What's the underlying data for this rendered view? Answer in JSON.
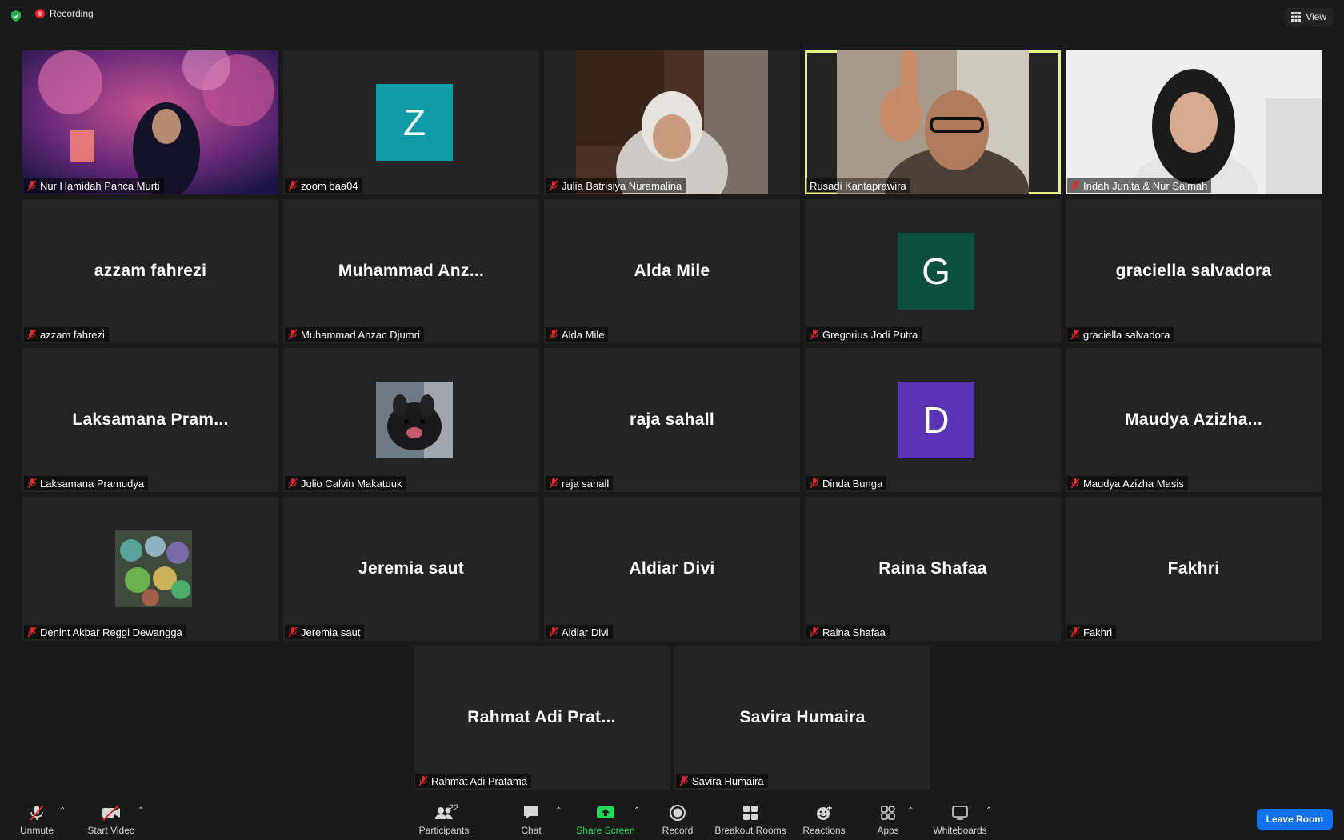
{
  "topbar": {
    "recording_label": "Recording",
    "view_label": "View"
  },
  "participants": [
    {
      "label": "Nur Hamidah Panca Murti"
    },
    {
      "label": "zoom baa04",
      "avatar_letter": "Z",
      "avatar_color": "#0e9aa7"
    },
    {
      "label": "Julia Batrisiya Nuramalina"
    },
    {
      "label": "Rusadi Kantaprawira"
    },
    {
      "label": "Indah Junita & Nur Salmah"
    },
    {
      "label": "azzam fahrezi",
      "display": "azzam fahrezi"
    },
    {
      "label": "Muhammad Anzac Djumri",
      "display": "Muhammad  Anz..."
    },
    {
      "label": "Alda Mile",
      "display": "Alda Mile"
    },
    {
      "label": "Gregorius Jodi Putra",
      "avatar_letter": "G",
      "avatar_color": "#0b4f3f"
    },
    {
      "label": "graciella salvadora",
      "display": "graciella salvadora"
    },
    {
      "label": "Laksamana Pramudya",
      "display": "Laksamana  Pram..."
    },
    {
      "label": "Julio Calvin Makatuuk"
    },
    {
      "label": "raja sahall",
      "display": "raja sahall"
    },
    {
      "label": "Dinda Bunga",
      "avatar_letter": "D",
      "avatar_color": "#5b33b5"
    },
    {
      "label": "Maudya Azizha Masis",
      "display": "Maudya  Azizha..."
    },
    {
      "label": "Denint Akbar Reggi Dewangga"
    },
    {
      "label": "Jeremia saut",
      "display": "Jeremia saut"
    },
    {
      "label": "Aldiar Divi",
      "display": "Aldiar Divi"
    },
    {
      "label": "Raina Shafaa",
      "display": "Raina Shafaa"
    },
    {
      "label": "Fakhri",
      "display": "Fakhri"
    },
    {
      "label": "Rahmat Adi Pratama",
      "display": "Rahmat Adi Prat..."
    },
    {
      "label": "Savira Humaira",
      "display": "Savira Humaira"
    }
  ],
  "toolbar": {
    "unmute": "Unmute",
    "start_video": "Start Video",
    "participants": "Participants",
    "participants_count": "22",
    "chat": "Chat",
    "share_screen": "Share Screen",
    "record": "Record",
    "breakout_rooms": "Breakout Rooms",
    "reactions": "Reactions",
    "apps": "Apps",
    "whiteboards": "Whiteboards",
    "leave_room": "Leave Room"
  },
  "colors": {
    "background": "#1a1a1a",
    "tile": "#242424",
    "active_speaker": "#e5f087",
    "share_green": "#23d959",
    "leave_blue": "#0e72ed",
    "muted_red": "#e02828"
  }
}
